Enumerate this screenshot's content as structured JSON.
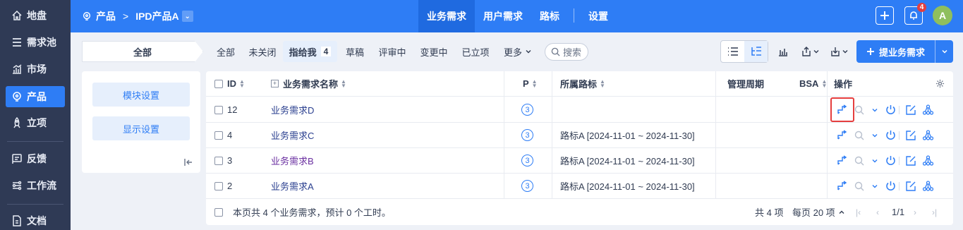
{
  "sidebar": {
    "items": [
      {
        "label": "地盘",
        "icon": "home-icon"
      },
      {
        "label": "需求池",
        "icon": "list-icon"
      },
      {
        "label": "市场",
        "icon": "market-icon"
      },
      {
        "label": "产品",
        "icon": "product-icon",
        "active": true
      },
      {
        "label": "立项",
        "icon": "rocket-icon"
      },
      {
        "label": "反馈",
        "icon": "feedback-icon"
      },
      {
        "label": "工作流",
        "icon": "workflow-icon"
      },
      {
        "label": "文档",
        "icon": "doc-icon"
      }
    ]
  },
  "topbar": {
    "breadcrumb": [
      "产品",
      "IPD产品A"
    ],
    "tabs": [
      "业务需求",
      "用户需求",
      "路标",
      "设置"
    ],
    "active_tab": "业务需求",
    "notification_count": "4",
    "avatar_letter": "A"
  },
  "filters": {
    "all_label": "全部",
    "tabs": [
      {
        "label": "全部"
      },
      {
        "label": "未关闭"
      },
      {
        "label": "指给我",
        "count": "4",
        "active": true
      },
      {
        "label": "草稿"
      },
      {
        "label": "评审中"
      },
      {
        "label": "变更中"
      },
      {
        "label": "已立项"
      },
      {
        "label": "更多"
      }
    ],
    "search_label": "搜索",
    "create_button": "提业务需求"
  },
  "left_panel": {
    "module_settings": "模块设置",
    "display_settings": "显示设置"
  },
  "table": {
    "headers": {
      "id": "ID",
      "name": "业务需求名称",
      "priority": "P",
      "roadmap": "所属路标",
      "cycle": "管理周期",
      "bsa": "BSA",
      "actions": "操作"
    },
    "rows": [
      {
        "id": "12",
        "name": "业务需求D",
        "priority": "3",
        "roadmap": "",
        "visited": false
      },
      {
        "id": "4",
        "name": "业务需求C",
        "priority": "3",
        "roadmap": "路标A [2024-11-01 ~ 2024-11-30]",
        "visited": false
      },
      {
        "id": "3",
        "name": "业务需求B",
        "priority": "3",
        "roadmap": "路标A [2024-11-01 ~ 2024-11-30]",
        "visited": true
      },
      {
        "id": "2",
        "name": "业务需求A",
        "priority": "3",
        "roadmap": "路标A [2024-11-01 ~ 2024-11-30]",
        "visited": false
      }
    ],
    "footer_summary": "本页共 4 个业务需求，预计 0 个工时。",
    "total": "共 4 项",
    "per_page": "每页 20 项",
    "page": "1/1"
  },
  "colors": {
    "accent": "#2e7df5",
    "sidebar_bg": "#2f3a55",
    "highlight": "#e53e3e"
  }
}
